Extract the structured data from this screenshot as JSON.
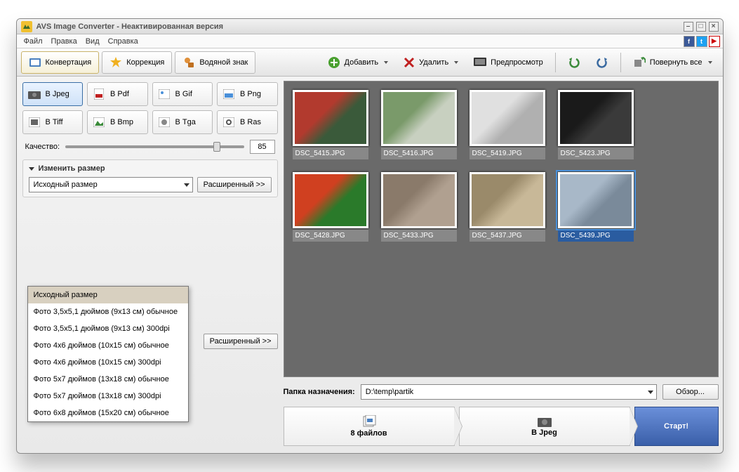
{
  "titlebar": {
    "title": "AVS Image Converter - Неактивированная версия"
  },
  "menu": {
    "file": "Файл",
    "edit": "Правка",
    "view": "Вид",
    "help": "Справка"
  },
  "tabs": {
    "convert": "Конвертация",
    "correct": "Коррекция",
    "watermark": "Водяной знак"
  },
  "toolbar": {
    "add": "Добавить",
    "delete": "Удалить",
    "preview": "Предпросмотр",
    "rotate_all": "Повернуть все"
  },
  "formats": {
    "jpeg": "В Jpeg",
    "pdf": "В Pdf",
    "gif": "В Gif",
    "png": "В Png",
    "tiff": "В Tiff",
    "bmp": "В Bmp",
    "tga": "В Tga",
    "ras": "В Ras"
  },
  "quality": {
    "label": "Качество:",
    "value": "85",
    "percent": 85
  },
  "resize": {
    "title": "Изменить размер",
    "selected": "Исходный размер",
    "advanced": "Расширенный >>",
    "options": [
      "Исходный размер",
      "Фото 3,5x5,1 дюймов (9x13 см) обычное",
      "Фото 3,5x5,1 дюймов (9x13 см) 300dpi",
      "Фото 4x6 дюймов (10x15 см) обычное",
      "Фото 4x6 дюймов (10x15 см) 300dpi",
      "Фото 5x7 дюймов (13x18 см) обычное",
      "Фото 5x7 дюймов (13x18 см) 300dpi",
      "Фото 6x8 дюймов (15x20 см) обычное"
    ]
  },
  "rename": {
    "advanced": "Расширенный >>"
  },
  "thumbs": [
    {
      "name": "DSC_5415.JPG",
      "colors": [
        "#b23a2e",
        "#3a5a3a"
      ]
    },
    {
      "name": "DSC_5416.JPG",
      "colors": [
        "#7a9a6a",
        "#c8d0c0"
      ]
    },
    {
      "name": "DSC_5419.JPG",
      "colors": [
        "#e0e0e0",
        "#b0b0b0"
      ]
    },
    {
      "name": "DSC_5423.JPG",
      "colors": [
        "#1a1a1a",
        "#3a3a3a"
      ]
    },
    {
      "name": "DSC_5428.JPG",
      "colors": [
        "#d04020",
        "#2a7a2a"
      ]
    },
    {
      "name": "DSC_5433.JPG",
      "colors": [
        "#8a7a6a",
        "#b0a090"
      ]
    },
    {
      "name": "DSC_5437.JPG",
      "colors": [
        "#9a8a6a",
        "#c8b898"
      ]
    },
    {
      "name": "DSC_5439.JPG",
      "colors": [
        "#a8b8c8",
        "#7a8a9a"
      ],
      "selected": true
    }
  ],
  "dest": {
    "label": "Папка назначения:",
    "path": "D:\\temp\\partik",
    "browse": "Обзор..."
  },
  "steps": {
    "count": "8 файлов",
    "format": "В Jpeg",
    "start": "Старт!"
  }
}
